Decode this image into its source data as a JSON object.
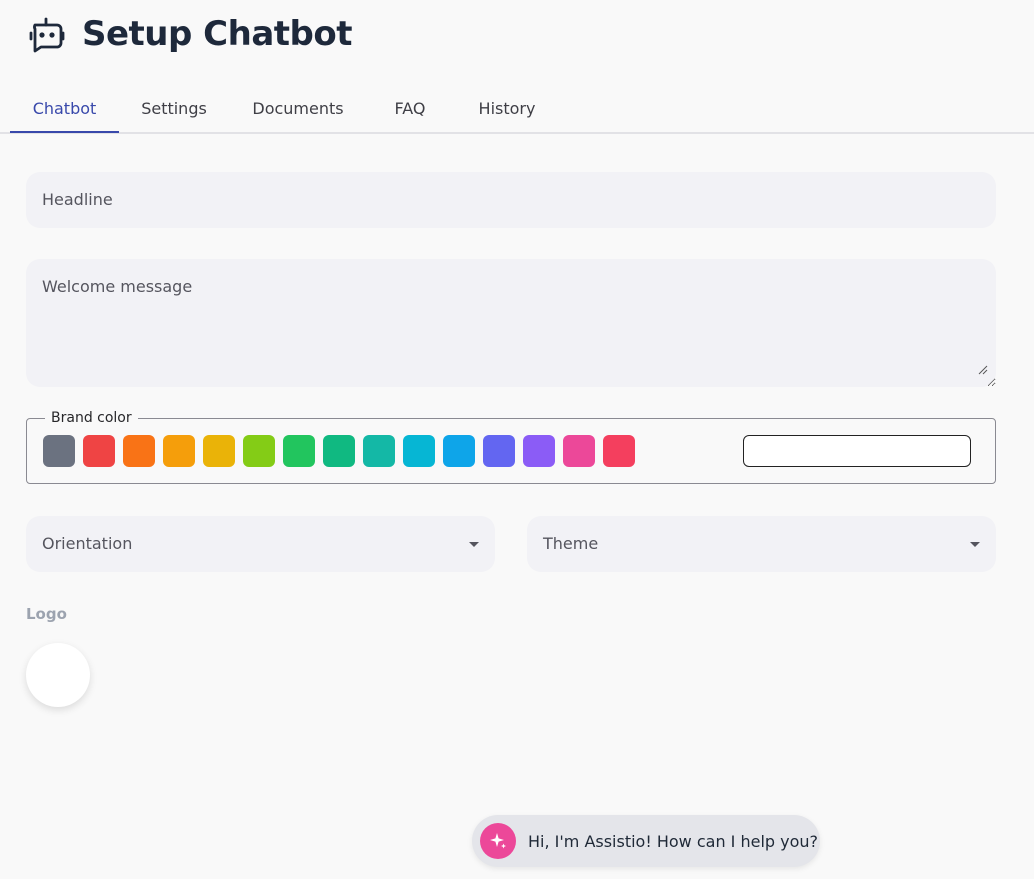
{
  "header": {
    "title": "Setup Chatbot",
    "icon": "robot-icon"
  },
  "tabs": [
    {
      "label": "Chatbot",
      "active": true
    },
    {
      "label": "Settings",
      "active": false
    },
    {
      "label": "Documents",
      "active": false
    },
    {
      "label": "FAQ",
      "active": false
    },
    {
      "label": "History",
      "active": false
    }
  ],
  "form": {
    "headline": {
      "label": "Headline",
      "value": ""
    },
    "welcome_message": {
      "label": "Welcome message",
      "value": ""
    },
    "brand_color": {
      "legend": "Brand color",
      "value": "",
      "swatches": [
        "#6b7280",
        "#ef4444",
        "#f97316",
        "#f59e0b",
        "#eab308",
        "#84cc16",
        "#22c55e",
        "#10b981",
        "#14b8a6",
        "#06b6d4",
        "#0ea5e9",
        "#6366f1",
        "#8b5cf6",
        "#ec4899",
        "#f43f5e"
      ]
    },
    "orientation": {
      "label": "Orientation",
      "value": ""
    },
    "theme": {
      "label": "Theme",
      "value": ""
    },
    "logo": {
      "label": "Logo"
    }
  },
  "chat_widget": {
    "message": "Hi, I'm Assistio! How can I help you?",
    "icon": "sparkle-icon",
    "accent": "#ec4899"
  },
  "colors": {
    "tab_active": "#3949ab",
    "field_bg": "#f2f2f6"
  }
}
